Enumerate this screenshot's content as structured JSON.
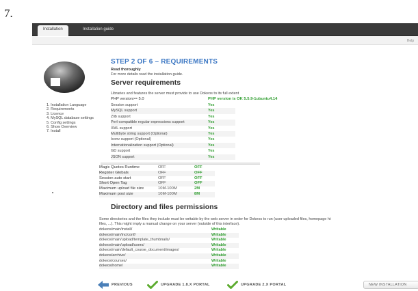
{
  "step_number": "7.",
  "header": {
    "tabs": [
      {
        "label": "Installation"
      },
      {
        "label": "Installation guide"
      }
    ],
    "help_label": "Help"
  },
  "sidebar": {
    "steps": [
      "1. Installation Language",
      "2. Requirements",
      "3. Licence",
      "4. MySQL database settings",
      "5. Config settings",
      "6. Show Overview",
      "7. Install"
    ]
  },
  "main": {
    "heading": "STEP 2 OF 6 – REQUIREMENTS",
    "read_title": "Read thoroughly",
    "read_text": "For more details read the installation guide.",
    "server": {
      "title": "Server requirements",
      "intro": "Libraries and features the server must provide to use Dokeos to its full extent",
      "php_label": "PHP version>= 5.0",
      "php_value": "PHP version is OK 5.5.9-1ubuntu4.14",
      "rows": [
        {
          "label": "Session support",
          "value": "Yes"
        },
        {
          "label": "MySQL support",
          "value": "Yes"
        },
        {
          "label": "Zlib support",
          "value": "Yes"
        },
        {
          "label": "Perl-compatible regular expressions support",
          "value": "Yes"
        },
        {
          "label": "XML support",
          "value": "Yes"
        },
        {
          "label": "Multibyte string support (Optional)",
          "value": "Yes"
        },
        {
          "label": "Iconv support (Optional)",
          "value": "Yes"
        },
        {
          "label": "Internationalization support (Optional)",
          "value": "Yes"
        },
        {
          "label": "GD support",
          "value": "Yes"
        },
        {
          "label": "JSON support",
          "value": "Yes"
        }
      ]
    },
    "settings": {
      "rows": [
        {
          "label": "Magic Quotes Runtime",
          "expected": "OFF",
          "current": "OFF"
        },
        {
          "label": "Register Globals",
          "expected": "OFF",
          "current": "OFF"
        },
        {
          "label": "Session auto start",
          "expected": "OFF",
          "current": "OFF"
        },
        {
          "label": "Short Open Tag",
          "expected": "OFF",
          "current": "OFF"
        },
        {
          "label": "Maximum upload file size",
          "expected": "10M-100M",
          "current": "2M"
        },
        {
          "label": "Maximum post size",
          "expected": "10M-100M",
          "current": "8M"
        }
      ]
    },
    "directories": {
      "title": "Directory and files permissions",
      "text_line1": "Some directories and the files they include must be writable by the web server in order for Dokeos to run (user uploaded files, homepage ht",
      "text_line2": "files, ...). This might imply a manual change on your server (outside of this interface).",
      "rows": [
        {
          "path": "dokeos/main/install/",
          "status": "Writable"
        },
        {
          "path": "dokeos/main/inc/conf/",
          "status": "Writable"
        },
        {
          "path": "dokeos/main/upload/template_thumbnails/",
          "status": "Writable"
        },
        {
          "path": "dokeos/main/upload/users/",
          "status": "Writable"
        },
        {
          "path": "dokeos/main/default_course_document/images/",
          "status": "Writable"
        },
        {
          "path": "dokeos/archive/",
          "status": "Writable"
        },
        {
          "path": "dokeos/courses/",
          "status": "Writable"
        },
        {
          "path": "dokeos/home/",
          "status": "Writable"
        }
      ]
    }
  },
  "footer": {
    "previous_label": "PREVIOUS",
    "upgrade18_label": "UPGRADE 1.8.X PORTAL",
    "upgrade2x_label": "UPGRADE 2.X PORTAL",
    "new_install_label": "NEW INSTALLATION"
  },
  "colors": {
    "accent": "#3d78c4",
    "ok": "#2e9d2e",
    "topbar": "#3a3a3a"
  }
}
